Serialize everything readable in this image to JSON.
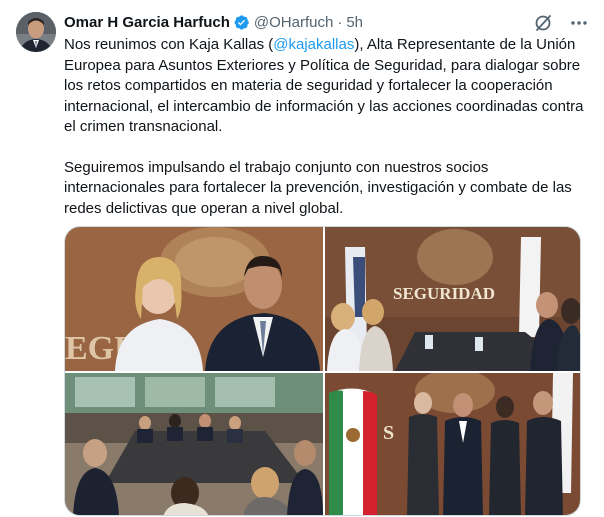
{
  "tweet": {
    "author_name": "Omar H Garcia Harfuch",
    "handle": "@OHarfuch",
    "separator": "·",
    "time": "5h",
    "paragraph1_before": "Nos reunimos con Kaja Kallas (",
    "mention": "@kajakallas",
    "paragraph1_after": "), Alta Representante de la Unión Europea para Asuntos Exteriores y Política de Seguridad, para dialogar sobre los retos compartidos en materia de seguridad y fortalecer la cooperación internacional, el intercambio de información y las acciones coordinadas contra el crimen transnacional.",
    "paragraph2": "Seguiremos impulsando el trabajo conjunto con nuestros socios internacionales para fortalecer la prevención, investigación y combate de las redes delictivas que operan a nivel global."
  },
  "photos": {
    "photo2_wall_text": "SEGURIDAD",
    "photo1_wall_text": "EGURI",
    "photo4_wall_text": "S"
  },
  "colors": {
    "verified_blue": "#1d9bf0",
    "mention_blue": "#1d9bf0",
    "secondary_text": "#536471"
  },
  "icons": {
    "verified": "verified-badge-icon",
    "grok": "grok-icon",
    "more": "more-options-icon"
  }
}
